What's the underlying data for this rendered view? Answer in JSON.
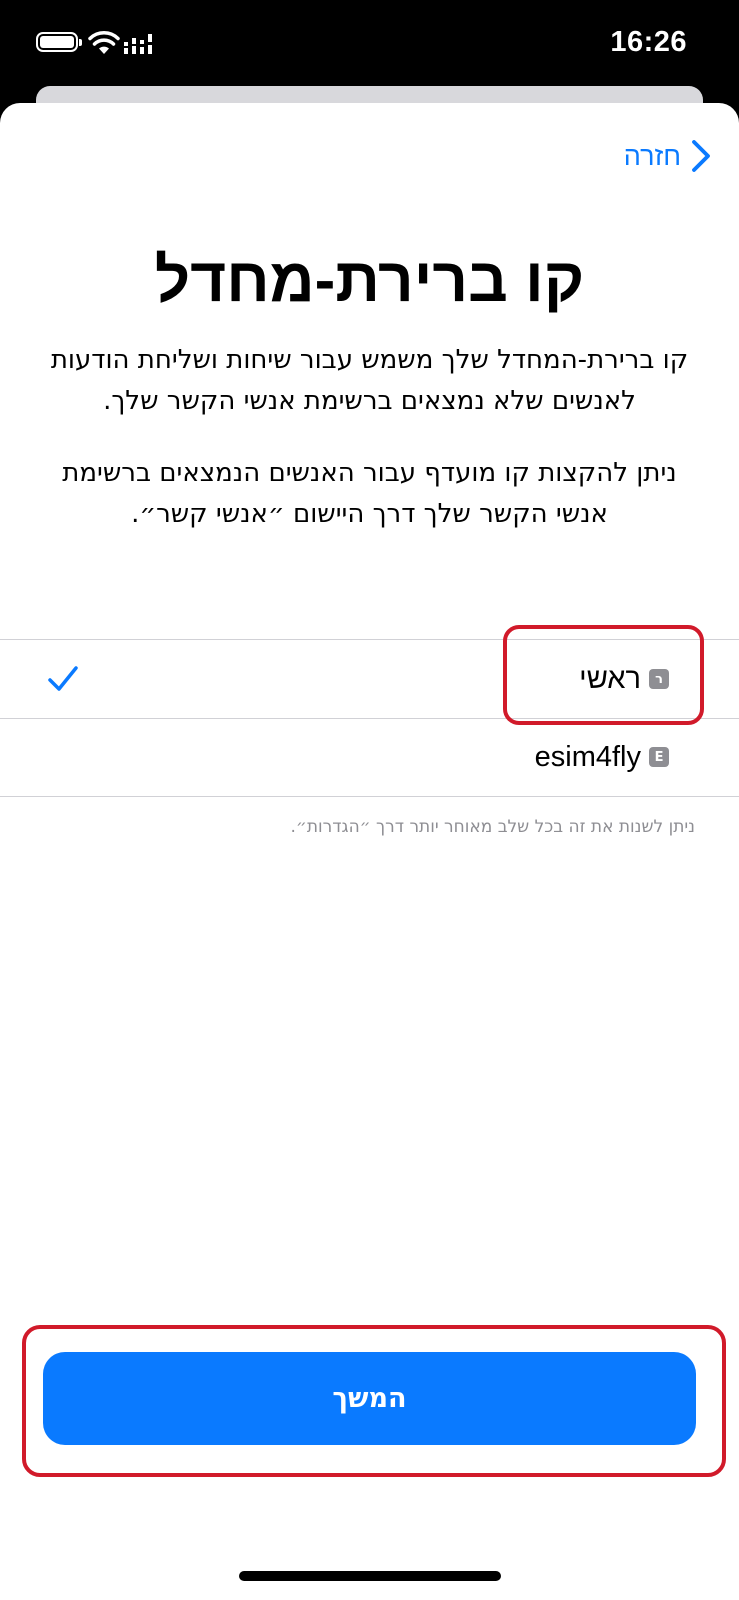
{
  "status_bar": {
    "time": "16:26",
    "icons": [
      "battery-icon",
      "wifi-icon",
      "signal-icon"
    ]
  },
  "nav": {
    "back_label": "חזרה",
    "back_icon": "chevron-right-icon"
  },
  "title": "קו ברירת-מחדל",
  "description": {
    "paragraph1": "קו ברירת-המחדל שלך משמש עבור שיחות ושליחת הודעות לאנשים שלא נמצאים ברשימת אנשי הקשר שלך.",
    "paragraph2": "ניתן להקצות קו מועדף עבור האנשים הנמצאים ברשימת אנשי הקשר שלך דרך היישום ״אנשי קשר״."
  },
  "lines": [
    {
      "badge": "ר",
      "label": "ראשי",
      "selected": true
    },
    {
      "badge": "E",
      "label": "esim4fly",
      "selected": false
    }
  ],
  "footnote": "ניתן לשנות את זה בכל שלב מאוחר יותר דרך ״הגדרות״.",
  "continue_button": "המשך",
  "colors": {
    "accent": "#0a7aff",
    "highlight": "#d11a2a",
    "separator": "#d1d1d6",
    "secondary_text": "#8e8e93"
  }
}
